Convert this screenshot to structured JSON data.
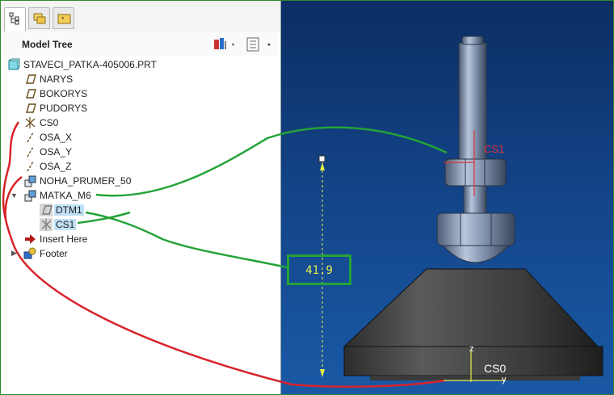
{
  "tree_panel": {
    "title": "Model Tree",
    "items": [
      {
        "label": "STAVECI_PATKA-405006.PRT",
        "icon": "part-icon"
      },
      {
        "label": "NARYS",
        "icon": "datum-plane-icon"
      },
      {
        "label": "BOKORYS",
        "icon": "datum-plane-icon"
      },
      {
        "label": "PUDORYS",
        "icon": "datum-plane-icon"
      },
      {
        "label": "CS0",
        "icon": "coordinate-system-icon"
      },
      {
        "label": "OSA_X",
        "icon": "datum-axis-icon"
      },
      {
        "label": "OSA_Y",
        "icon": "datum-axis-icon"
      },
      {
        "label": "OSA_Z",
        "icon": "datum-axis-icon"
      },
      {
        "label": "NOHA_PRUMER_50",
        "icon": "feature-icon"
      },
      {
        "label": "MATKA_M6",
        "icon": "feature-icon"
      },
      {
        "label": "DTM1",
        "icon": "datum-plane-icon"
      },
      {
        "label": "CS1",
        "icon": "coordinate-system-icon"
      },
      {
        "label": "Insert Here",
        "icon": "insert-arrow-icon"
      },
      {
        "label": "Footer",
        "icon": "footer-icon"
      }
    ]
  },
  "viewport": {
    "cs1_label": "CS1",
    "cs0_label": "CS0",
    "z_label": "z",
    "y_label": "y",
    "dimension_value": "41.9"
  },
  "colors": {
    "background_top": "#0c2e63",
    "background_bottom": "#1a59a6",
    "annotation_green": "#24a338",
    "annotation_red": "#d8232a",
    "dimension_yellow": "#e5ef4a",
    "cs_red": "#e0303a"
  }
}
